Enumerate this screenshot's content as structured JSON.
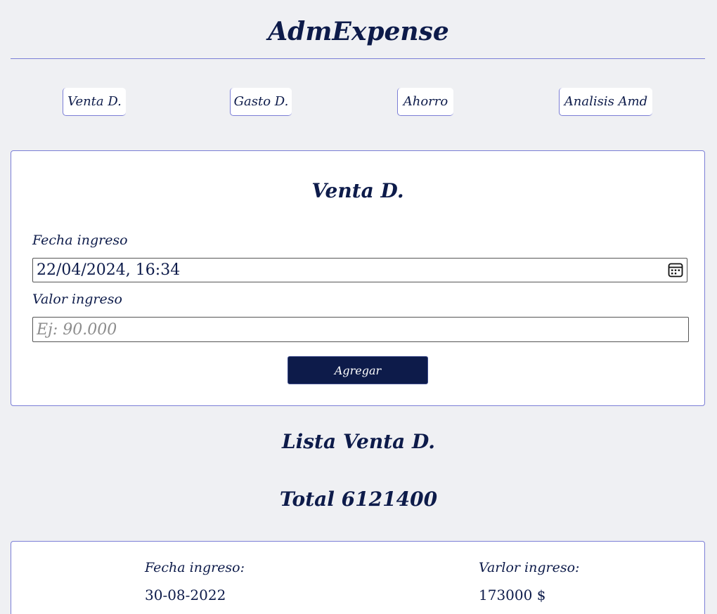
{
  "app": {
    "title": "AdmExpense"
  },
  "nav": {
    "items": [
      {
        "label": "Venta D."
      },
      {
        "label": "Gasto D."
      },
      {
        "label": "Ahorro"
      },
      {
        "label": "Analisis Amd"
      }
    ]
  },
  "form": {
    "title": "Venta D.",
    "date_label": "Fecha ingreso",
    "date_value": "22/04/2024, 16:34",
    "value_label": "Valor ingreso",
    "value_placeholder": "Ej: 90.000",
    "submit_label": "Agregar"
  },
  "list": {
    "title": "Lista Venta D.",
    "total_label": "Total 6121400",
    "entries": [
      {
        "date_label": "Fecha ingreso:",
        "date_value": "30-08-2022",
        "value_label": "Varlor ingreso:",
        "value_value": "173000 $"
      }
    ]
  },
  "colors": {
    "background": "#eff0f3",
    "primary": "#0d1b4a",
    "border": "#7b7ed6"
  }
}
